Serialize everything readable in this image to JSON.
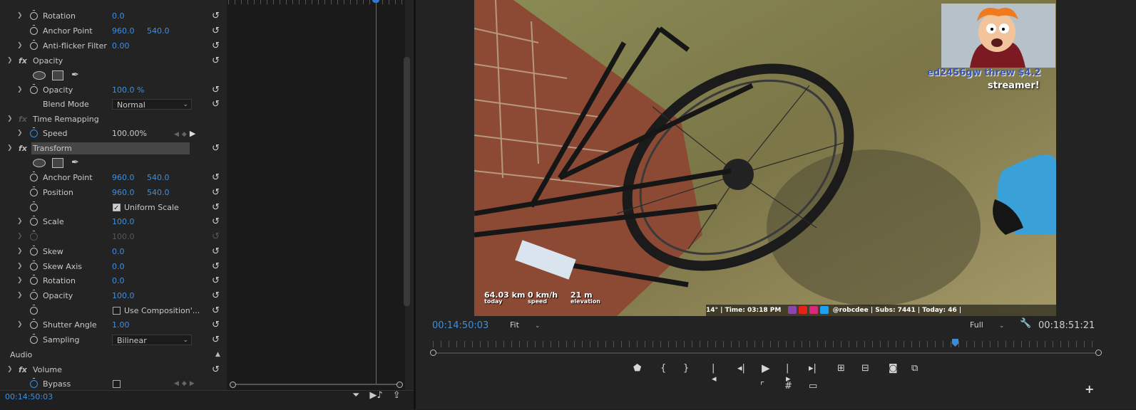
{
  "effect_controls": {
    "rows": [
      {
        "label": "Rotation",
        "v1": "0.0"
      },
      {
        "label": "Anchor Point",
        "v1": "960.0",
        "v2": "540.0"
      },
      {
        "label": "Anti-flicker Filter",
        "v1": "0.00"
      },
      {
        "label": "Opacity"
      },
      {
        "label": "Opacity",
        "v1": "100.0 %"
      },
      {
        "label": "Blend Mode",
        "dropdown": "Normal"
      },
      {
        "label": "Time Remapping"
      },
      {
        "label": "Speed",
        "v1": "100.00%"
      },
      {
        "label": "Transform"
      },
      {
        "label": "Anchor Point",
        "v1": "960.0",
        "v2": "540.0"
      },
      {
        "label": "Position",
        "v1": "960.0",
        "v2": "540.0"
      },
      {
        "checkbox": "Uniform Scale"
      },
      {
        "label": "Scale",
        "v1": "100.0"
      },
      {
        "v1": "100.0"
      },
      {
        "label": "Skew",
        "v1": "0.0"
      },
      {
        "label": "Skew Axis",
        "v1": "0.0"
      },
      {
        "label": "Rotation",
        "v1": "0.0"
      },
      {
        "label": "Opacity",
        "v1": "100.0"
      },
      {
        "checkbox": "Use Composition'..."
      },
      {
        "label": "Shutter Angle",
        "v1": "1.00"
      },
      {
        "label": "Sampling",
        "dropdown": "Bilinear"
      },
      {
        "label": "Audio"
      },
      {
        "label": "Volume"
      },
      {
        "label": "Bypass"
      }
    ],
    "timecode": "00:14:50:03"
  },
  "monitor": {
    "timecode_current": "00:14:50:03",
    "timecode_duration": "00:18:51:21",
    "zoom": "Fit",
    "resolution": "Full",
    "video_overlay": {
      "donation_user": "ed2456gw threw $4.2",
      "donation_line2": "streamer!",
      "stat1_value": "64.03 km",
      "stat1_label": "today",
      "stat2_value": "0 km/h",
      "stat2_label": "speed",
      "stat3_value": "21 m",
      "stat3_label": "elevation",
      "info_bar": "14° | Time: 03:18 PM",
      "handle": "@robcdee",
      "subs": "| Subs: 7441 | Today: 46 |"
    }
  },
  "colors": {
    "accent": "#2b7ad6",
    "value_blue": "#3f8fe0"
  }
}
